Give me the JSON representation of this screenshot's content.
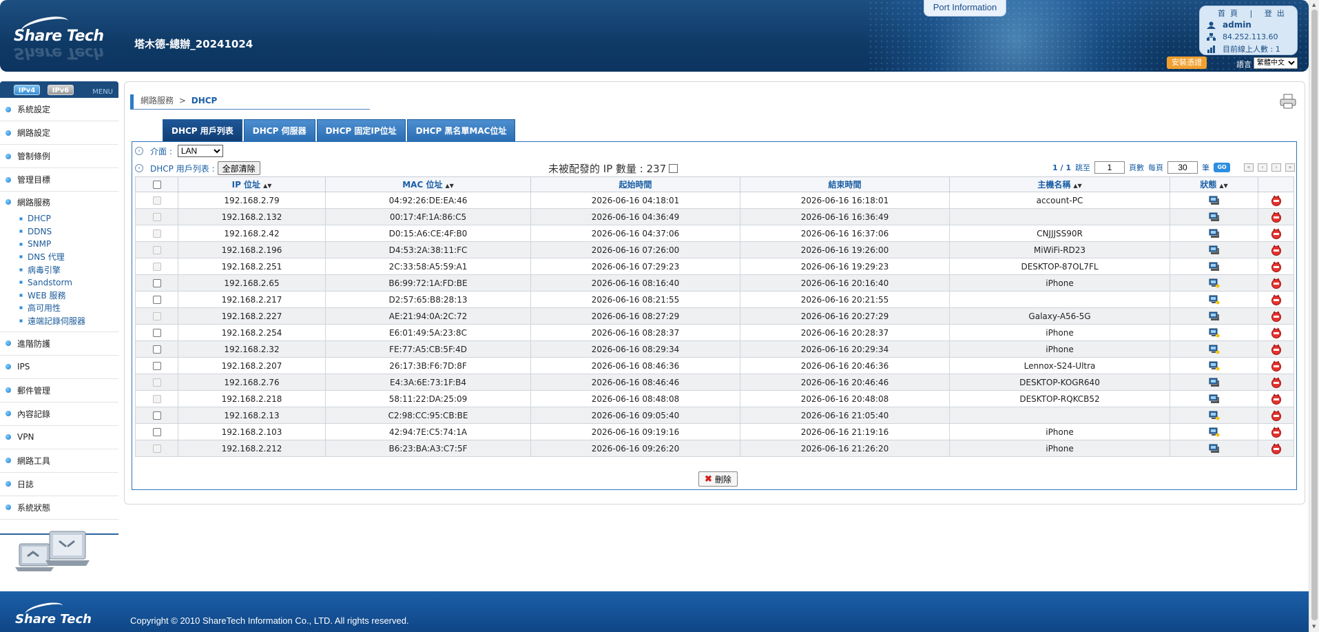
{
  "header": {
    "site_title": "塔木德-總辦_20241024",
    "port_information": "Port Information",
    "links": "首頁 | 登出",
    "user": "admin",
    "ip": "84.252.113.60",
    "online_users": "目前線上人數 : 1",
    "install_cert": "安裝憑證",
    "lang_label": "語言",
    "lang_value": "繁體中文",
    "logo": "Share Tech"
  },
  "sidebar": {
    "proto_ipv4": "IPv4",
    "proto_ipv6": "IPv6",
    "menu_label": "MENU",
    "items": [
      {
        "label": "系統設定"
      },
      {
        "label": "網路設定"
      },
      {
        "label": "管制條例"
      },
      {
        "label": "管理目標"
      },
      {
        "label": "網路服務"
      },
      {
        "label": "進階防護"
      },
      {
        "label": "IPS"
      },
      {
        "label": "郵件管理"
      },
      {
        "label": "內容記錄"
      },
      {
        "label": "VPN"
      },
      {
        "label": "網路工具"
      },
      {
        "label": "日誌"
      },
      {
        "label": "系統狀態"
      }
    ],
    "sub_items": [
      {
        "label": "DHCP"
      },
      {
        "label": "DDNS"
      },
      {
        "label": "SNMP"
      },
      {
        "label": "DNS 代理"
      },
      {
        "label": "病毒引擎"
      },
      {
        "label": "Sandstorm"
      },
      {
        "label": "WEB 服務"
      },
      {
        "label": "高可用性"
      },
      {
        "label": "遠端記錄伺服器"
      }
    ]
  },
  "breadcrumb": {
    "parent": "網路服務",
    "sep": ">",
    "current": "DHCP"
  },
  "tabs": [
    {
      "label": "DHCP 用戶列表"
    },
    {
      "label": "DHCP 伺服器"
    },
    {
      "label": "DHCP 固定IP位址"
    },
    {
      "label": "DHCP 黑名單MAC位址"
    }
  ],
  "toolbar": {
    "iface_label": "介面 :",
    "iface_value": "LAN",
    "list_label": "DHCP 用戶列表 :",
    "clear_all": "全部清除",
    "unassigned": "未被配發的 IP 數量 : 237",
    "page": "1 / 1",
    "jump_to": "跳至",
    "jump_value": "1",
    "page_unit": "頁數",
    "per_page": "每頁",
    "per_page_value": "30",
    "per_unit": "筆",
    "go": "GO"
  },
  "table": {
    "headers": {
      "ip": "IP 位址",
      "mac": "MAC 位址",
      "start": "起始時間",
      "end": "結束時間",
      "host": "主機名稱",
      "status": "狀態"
    },
    "rows": [
      {
        "ip": "192.168.2.79",
        "mac": "04:92:26:DE:EA:46",
        "start": "2026-06-16 04:18:01",
        "end": "2026-06-16 16:18:01",
        "host": "account-PC",
        "fixed": true
      },
      {
        "ip": "192.168.2.132",
        "mac": "00:17:4F:1A:86:C5",
        "start": "2026-06-16 04:36:49",
        "end": "2026-06-16 16:36:49",
        "host": "",
        "fixed": true
      },
      {
        "ip": "192.168.2.42",
        "mac": "D0:15:A6:CE:4F:B0",
        "start": "2026-06-16 04:37:06",
        "end": "2026-06-16 16:37:06",
        "host": "CNJJJSS90R",
        "fixed": true
      },
      {
        "ip": "192.168.2.196",
        "mac": "D4:53:2A:38:11:FC",
        "start": "2026-06-16 07:26:00",
        "end": "2026-06-16 19:26:00",
        "host": "MiWiFi-RD23",
        "fixed": true
      },
      {
        "ip": "192.168.2.251",
        "mac": "2C:33:58:A5:59:A1",
        "start": "2026-06-16 07:29:23",
        "end": "2026-06-16 19:29:23",
        "host": "DESKTOP-87OL7FL",
        "fixed": true
      },
      {
        "ip": "192.168.2.65",
        "mac": "B6:99:72:1A:FD:BE",
        "start": "2026-06-16 08:16:40",
        "end": "2026-06-16 20:16:40",
        "host": "iPhone",
        "fixed": false
      },
      {
        "ip": "192.168.2.217",
        "mac": "D2:57:65:B8:28:13",
        "start": "2026-06-16 08:21:55",
        "end": "2026-06-16 20:21:55",
        "host": "",
        "fixed": false
      },
      {
        "ip": "192.168.2.227",
        "mac": "AE:21:94:0A:2C:72",
        "start": "2026-06-16 08:27:29",
        "end": "2026-06-16 20:27:29",
        "host": "Galaxy-A56-5G",
        "fixed": true
      },
      {
        "ip": "192.168.2.254",
        "mac": "E6:01:49:5A:23:8C",
        "start": "2026-06-16 08:28:37",
        "end": "2026-06-16 20:28:37",
        "host": "iPhone",
        "fixed": false
      },
      {
        "ip": "192.168.2.32",
        "mac": "FE:77:A5:CB:5F:4D",
        "start": "2026-06-16 08:29:34",
        "end": "2026-06-16 20:29:34",
        "host": "iPhone",
        "fixed": false
      },
      {
        "ip": "192.168.2.207",
        "mac": "26:17:3B:F6:7D:8F",
        "start": "2026-06-16 08:46:36",
        "end": "2026-06-16 20:46:36",
        "host": "Lennox-S24-Ultra",
        "fixed": false
      },
      {
        "ip": "192.168.2.76",
        "mac": "E4:3A:6E:73:1F:B4",
        "start": "2026-06-16 08:46:46",
        "end": "2026-06-16 20:46:46",
        "host": "DESKTOP-KOGR640",
        "fixed": true
      },
      {
        "ip": "192.168.2.218",
        "mac": "58:11:22:DA:25:09",
        "start": "2026-06-16 08:48:08",
        "end": "2026-06-16 20:48:08",
        "host": "DESKTOP-RQKCB52",
        "fixed": true
      },
      {
        "ip": "192.168.2.13",
        "mac": "C2:98:CC:95:CB:BE",
        "start": "2026-06-16 09:05:40",
        "end": "2026-06-16 21:05:40",
        "host": "",
        "fixed": false
      },
      {
        "ip": "192.168.2.103",
        "mac": "42:94:7E:C5:74:1A",
        "start": "2026-06-16 09:19:16",
        "end": "2026-06-16 21:19:16",
        "host": "iPhone",
        "fixed": false
      },
      {
        "ip": "192.168.2.212",
        "mac": "B6:23:BA:A3:C7:5F",
        "start": "2026-06-16 09:26:20",
        "end": "2026-06-16 21:26:20",
        "host": "iPhone",
        "fixed": true
      }
    ]
  },
  "delete_label": "刪除",
  "footer": {
    "copyright": "Copyright © 2010 ShareTech Information Co., LTD. All rights reserved.",
    "logo": "Share Tech"
  }
}
